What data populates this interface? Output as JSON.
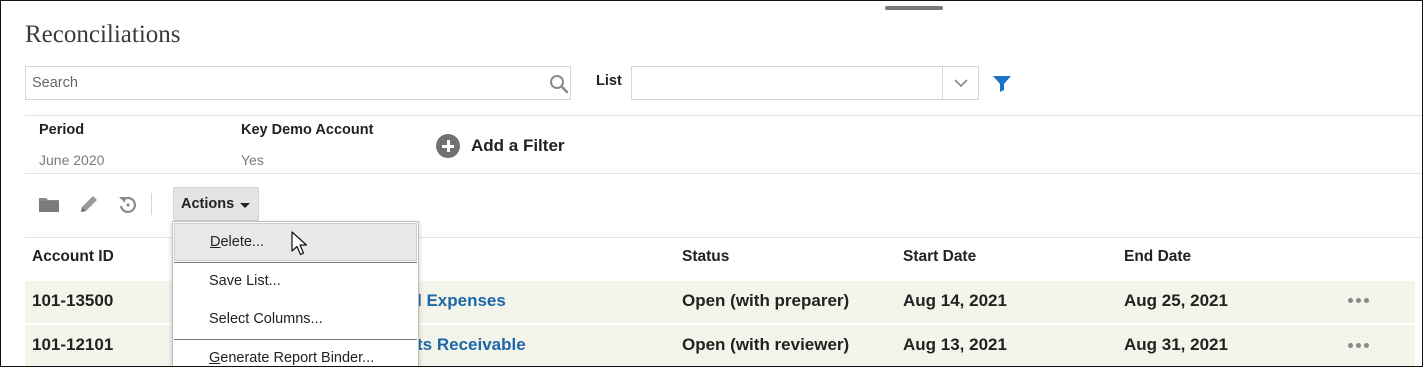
{
  "page": {
    "title": "Reconciliations"
  },
  "search": {
    "placeholder": "Search",
    "value": ""
  },
  "list_filter": {
    "label": "List",
    "value": ""
  },
  "filters": [
    {
      "label": "Period",
      "value": "June 2020"
    },
    {
      "label": "Key Demo Account",
      "value": "Yes"
    }
  ],
  "add_filter_label": "Add a Filter",
  "toolbar": {
    "actions_label": "Actions"
  },
  "actions_menu": {
    "items": [
      {
        "key": "D",
        "rest": "elete..."
      },
      {
        "label": "Save List..."
      },
      {
        "label": "Select Columns..."
      },
      {
        "key": "G",
        "rest": "enerate Report Binder..."
      }
    ]
  },
  "table": {
    "headers": {
      "account_id": "Account ID",
      "status": "Status",
      "start_date": "Start Date",
      "end_date": "End Date"
    },
    "rows": [
      {
        "account_id": "101-13500",
        "name": "l Expenses",
        "status": "Open (with preparer)",
        "start_date": "Aug 14, 2021",
        "end_date": "Aug 25, 2021"
      },
      {
        "account_id": "101-12101",
        "name": "ts Receivable",
        "status": "Open (with reviewer)",
        "start_date": "Aug 13, 2021",
        "end_date": "Aug 31, 2021"
      }
    ]
  },
  "colors": {
    "link": "#1d67a8",
    "filter_icon": "#1a73c7",
    "row_bg": "#f4f5ea",
    "menu_highlight": "#e9e9e9"
  },
  "icons": [
    "search-icon",
    "chevron-down-icon",
    "funnel-icon",
    "plus-circle-icon",
    "folder-icon",
    "pencil-icon",
    "refresh-icon",
    "caret-down-icon",
    "more-horizontal-icon",
    "mouse-pointer-icon"
  ]
}
